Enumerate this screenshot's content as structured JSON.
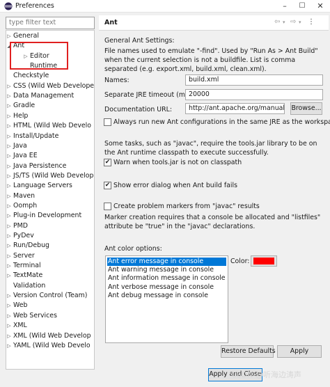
{
  "window": {
    "title": "Preferences"
  },
  "sidebar": {
    "filter_placeholder": "type filter text",
    "items": [
      {
        "label": "General",
        "arrow": "▷"
      },
      {
        "label": "Ant",
        "arrow": "◢"
      },
      {
        "label": "Editor",
        "arrow": "▷"
      },
      {
        "label": "Runtime",
        "arrow": ""
      },
      {
        "label": "Checkstyle",
        "arrow": ""
      },
      {
        "label": "CSS (Wild Web Develope",
        "arrow": "▷"
      },
      {
        "label": "Data Management",
        "arrow": "▷"
      },
      {
        "label": "Gradle",
        "arrow": "▷"
      },
      {
        "label": "Help",
        "arrow": "▷"
      },
      {
        "label": "HTML (Wild Web Develo",
        "arrow": "▷"
      },
      {
        "label": "Install/Update",
        "arrow": "▷"
      },
      {
        "label": "Java",
        "arrow": "▷"
      },
      {
        "label": "Java EE",
        "arrow": "▷"
      },
      {
        "label": "Java Persistence",
        "arrow": "▷"
      },
      {
        "label": "JS/TS (Wild Web Develop",
        "arrow": "▷"
      },
      {
        "label": "Language Servers",
        "arrow": "▷"
      },
      {
        "label": "Maven",
        "arrow": "▷"
      },
      {
        "label": "Oomph",
        "arrow": "▷"
      },
      {
        "label": "Plug-in Development",
        "arrow": "▷"
      },
      {
        "label": "PMD",
        "arrow": "▷"
      },
      {
        "label": "PyDev",
        "arrow": "▷"
      },
      {
        "label": "Run/Debug",
        "arrow": "▷"
      },
      {
        "label": "Server",
        "arrow": "▷"
      },
      {
        "label": "Terminal",
        "arrow": "▷"
      },
      {
        "label": "TextMate",
        "arrow": "▷"
      },
      {
        "label": "Validation",
        "arrow": ""
      },
      {
        "label": "Version Control (Team)",
        "arrow": "▷"
      },
      {
        "label": "Web",
        "arrow": "▷"
      },
      {
        "label": "Web Services",
        "arrow": "▷"
      },
      {
        "label": "XML",
        "arrow": "▷"
      },
      {
        "label": "XML (Wild Web Develop",
        "arrow": "▷"
      },
      {
        "label": "YAML (Wild Web Develo",
        "arrow": "▷"
      }
    ]
  },
  "page": {
    "title": "Ant",
    "general_label": "General Ant Settings:",
    "find_text": "File names used to emulate \"-find\". Used by \"Run As > Ant Build\" when the current selection is not a buildfile. List is comma separated (e.g. export.xml, build.xml, clean.xml).",
    "names_label": "Names:",
    "names_value": "build.xml",
    "timeout_label": "Separate JRE timeout (ms):",
    "timeout_value": "20000",
    "doc_url_label": "Documentation URL:",
    "doc_url_value": "http://ant.apache.org/manual",
    "browse_label": "Browse...",
    "always_run_label": "Always run new Ant configurations in the same JRE as the workspace",
    "always_run_checked": false,
    "tools_text": "Some tasks, such as \"javac\", require the tools.jar library to be on the Ant runtime classpath to execute successfully.",
    "warn_label": "Warn when tools.jar is not on classpath",
    "warn_checked": true,
    "show_error_label": "Show error dialog when Ant build fails",
    "show_error_checked": true,
    "problem_label": "Create problem markers from \"javac\" results",
    "problem_checked": false,
    "marker_text": "Marker creation requires that a console be allocated and \"listfiles\" attribute be \"true\" in the \"javac\" declarations.",
    "color_options_label": "Ant color options:",
    "color_items": [
      "Ant error message in console",
      "Ant warning message in console",
      "Ant information message in console",
      "Ant verbose message in console",
      "Ant debug message in console"
    ],
    "selected_color_item": 0,
    "color_label": "Color:",
    "selected_color": "#ff0000",
    "restore_label": "Restore Defaults",
    "apply_label": "Apply"
  },
  "footer": {
    "apply_close_label": "Apply and Close",
    "watermark": "CSDN @听海边涛声"
  }
}
